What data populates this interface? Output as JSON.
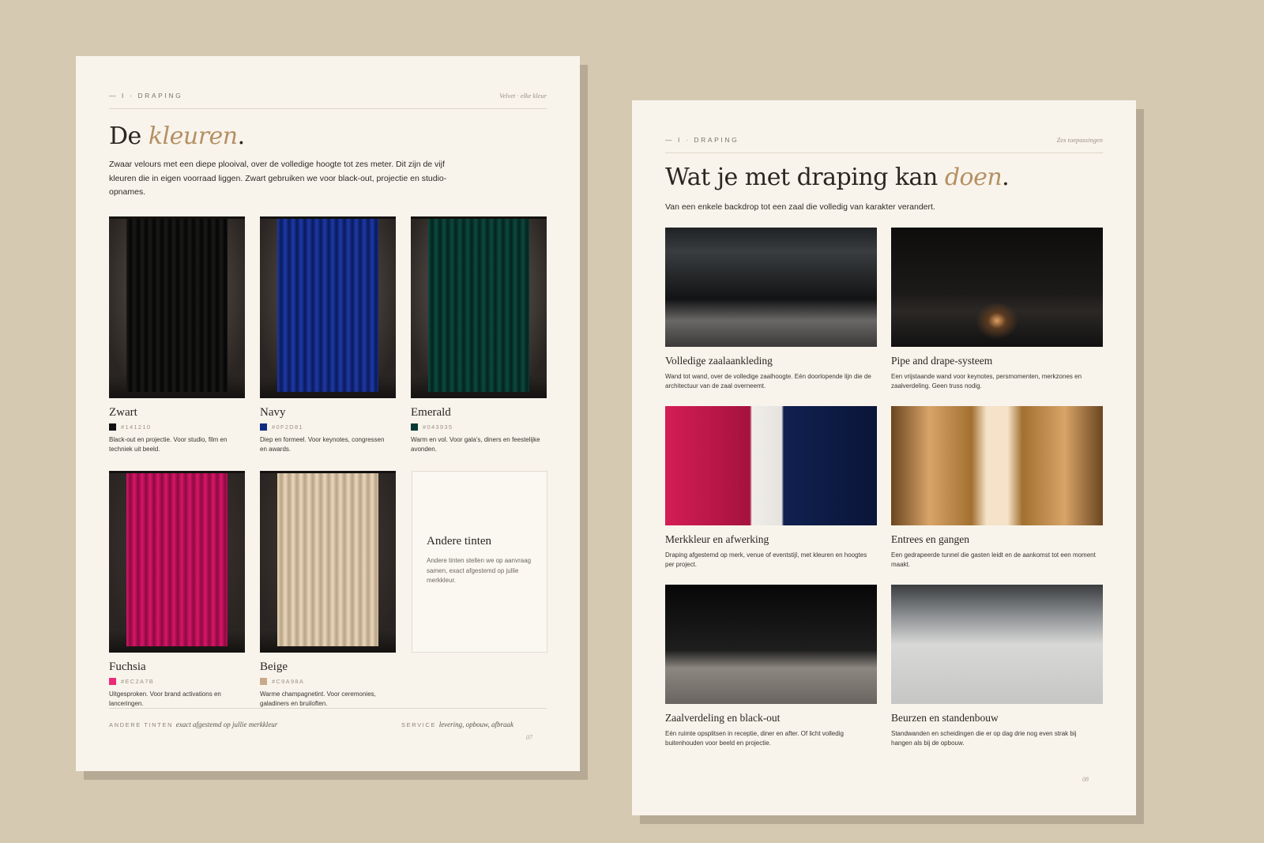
{
  "left_page": {
    "section": "— I · DRAPING",
    "running_title": "Velvet · elke kleur",
    "title_plain": "De ",
    "title_accent": "kleuren",
    "title_end": ".",
    "intro": "Zwaar velours met een diepe plooival, over de volledige hoogte tot zes meter. Dit zijn de vijf kleuren die in eigen voorraad liggen. Zwart gebruiken we voor black-out, projectie en studio-opnames.",
    "colors": [
      {
        "name": "Zwart",
        "hex": "#141210",
        "desc": "Black-out en projectie. Voor studio, film en techniek uit beeld.",
        "swatch": "#141210",
        "curtain_a": "#1b1a19",
        "curtain_b": "#050505",
        "wall": "#6b625b"
      },
      {
        "name": "Navy",
        "hex": "#0F2D81",
        "desc": "Diep en formeel. Voor keynotes, congressen en awards.",
        "swatch": "#0F2D81",
        "curtain_a": "#1e3aa8",
        "curtain_b": "#0a1a5a",
        "wall": "#6b625b"
      },
      {
        "name": "Emerald",
        "hex": "#043935",
        "desc": "Warm en vol. Voor gala's, diners en feestelijke avonden.",
        "swatch": "#043935",
        "curtain_a": "#0d4a40",
        "curtain_b": "#02241f",
        "wall": "#7a7069"
      },
      {
        "name": "Fuchsia",
        "hex": "#EC2A7B",
        "desc": "Uitgesproken. Voor brand activations en lanceringen.",
        "swatch": "#EC2A7B",
        "curtain_a": "#d9156a",
        "curtain_b": "#8c0a3f",
        "wall": "#4a3a3a"
      },
      {
        "name": "Beige",
        "hex": "#C9A98A",
        "desc": "Warme champagnetint. Voor ceremonies, galadiners en bruiloften.",
        "swatch": "#C9A98A",
        "curtain_a": "#e9d8bd",
        "curtain_b": "#b9a284",
        "wall": "#4a423c"
      }
    ],
    "other": {
      "title": "Andere tinten",
      "desc": "Andere tinten stellen we op aanvraag samen, exact afgestemd op jullie merkkleur."
    },
    "footer_left_label": "ANDERE TINTEN",
    "footer_left_text": "exact afgestemd op jullie merkkleur",
    "footer_right_label": "SERVICE",
    "footer_right_text": "levering, opbouw, afbraak",
    "page_number": "07"
  },
  "right_page": {
    "section": "— I · DRAPING",
    "running_title": "Zes toepassingen",
    "title_plain": "Wat je met draping kan ",
    "title_accent": "doen",
    "title_end": ".",
    "intro": "Van een enkele backdrop tot een zaal die volledig van karakter verandert.",
    "applications": [
      {
        "title": "Volledige zaalaankleding",
        "desc": "Wand tot wand, over de volledige zaalhoogte. Eén doorlopende lijn die de architectuur van de zaal overneemt."
      },
      {
        "title": "Pipe and drape-systeem",
        "desc": "Een vrijstaande wand voor keynotes, persmomenten, merkzones en zaalverdeling. Geen truss nodig."
      },
      {
        "title": "Merkkleur en afwerking",
        "desc": "Draping afgestemd op merk, venue of eventstijl, met kleuren en hoogtes per project."
      },
      {
        "title": "Entrees en gangen",
        "desc": "Een gedrapeerde tunnel die gasten leidt en de aankomst tot een moment maakt."
      },
      {
        "title": "Zaalverdeling en black-out",
        "desc": "Eén ruimte opsplitsen in receptie, diner en after. Of licht volledig buitenhouden voor beeld en projectie."
      },
      {
        "title": "Beurzen en standenbouw",
        "desc": "Standwanden en scheidingen die er op dag drie nog even strak bij hangen als bij de opbouw."
      }
    ],
    "page_number": "08"
  }
}
